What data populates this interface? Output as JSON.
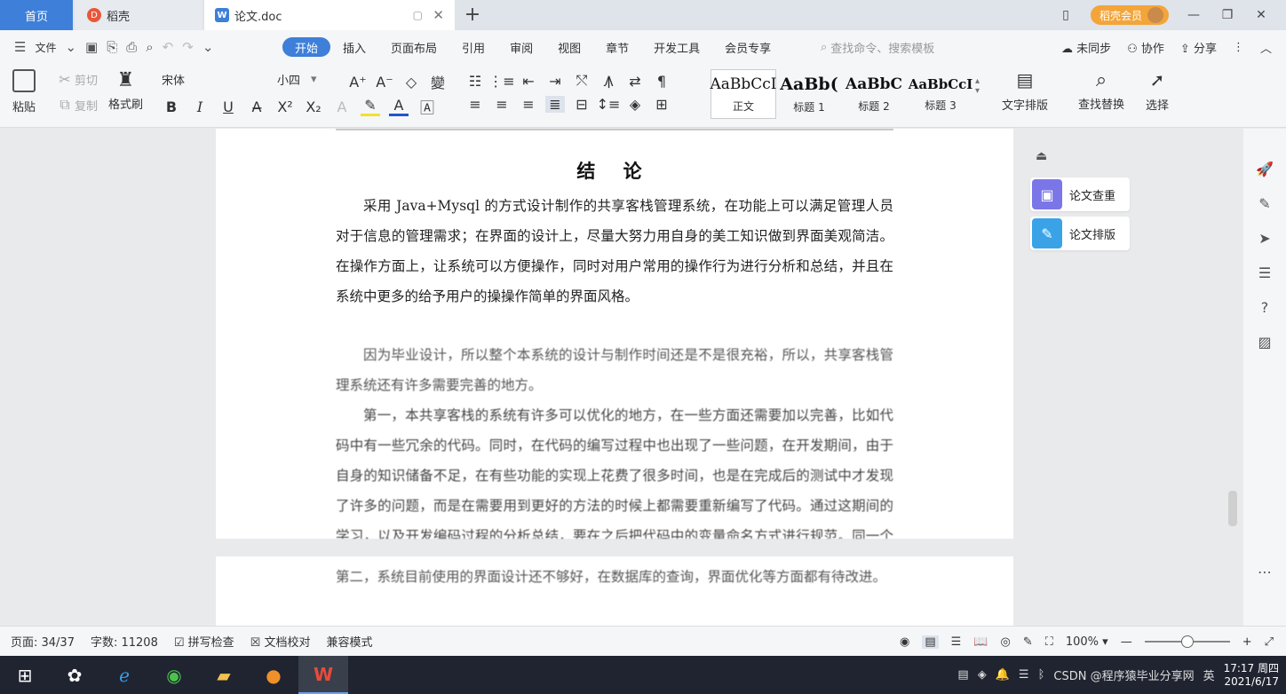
{
  "tabs": {
    "home": "首页",
    "daoke": "稻壳",
    "doc": "论文.doc",
    "new": "+"
  },
  "titlebar": {
    "member": "稻壳会员",
    "minimize": "—",
    "restore": "❐",
    "close": "✕"
  },
  "menu": {
    "file": "文件",
    "tabs": [
      "开始",
      "插入",
      "页面布局",
      "引用",
      "审阅",
      "视图",
      "章节",
      "开发工具",
      "会员专享"
    ],
    "search": "查找命令、搜索模板",
    "sync": "未同步",
    "collab": "协作",
    "share": "分享"
  },
  "ribbon": {
    "paste": "粘贴",
    "cut": "剪切",
    "copy": "复制",
    "format_painter": "格式刷",
    "font_name": "宋体",
    "font_size": "小四",
    "styles": [
      {
        "sample": "AaBbCcI",
        "name": "正文"
      },
      {
        "sample": "AaBb(",
        "name": "标题 1"
      },
      {
        "sample": "AaBbC",
        "name": "标题 2"
      },
      {
        "sample": "AaBbCcI",
        "name": "标题 3"
      }
    ],
    "text_layout": "文字排版",
    "find_replace": "查找替换",
    "select": "选择"
  },
  "document": {
    "title": "结  论",
    "p1": "采用 Java+Mysql 的方式设计制作的共享客栈管理系统，在功能上可以满足管理人员对于信息的管理需求；在界面的设计上，尽量大努力用自身的美工知识做到界面美观简洁。在操作方面上，让系统可以方便操作，同时对用户常用的操作行为进行分析和总结，并且在系统中更多的给予用户的操操作简单的界面风格。",
    "p2": "因为毕业设计，所以整个本系统的设计与制作时间还是不是很充裕，所以，共享客栈管理系统还有许多需要完善的地方。",
    "p3": "第一，本共享客栈的系统有许多可以优化的地方，在一些方面还需要加以完善，比如代码中有一些冗余的代码。同时，在代码的编写过程中也出现了一些问题，在开发期间，由于自身的知识储备不足，在有些功能的实现上花费了很多时间，也是在完成后的测试中才发现了许多的问题，而是在需要用到更好的方法的时候上都需要重新编写了代码。通过这期间的学习，以及开发编码过程的分析总结，要在之后把代码中的变量命名方式进行规范。同一个方面上，在之后的编码中，需要使用更高效的方法，即可以在以后的代码编写中让代码简洁，这样可以简化代码，也节省了开发时间和存储空间。",
    "p4": "第二，系统目前使用的界面设计还不够好，在数据库的查询，界面优化等方面都有待改进。"
  },
  "pane": {
    "check": "论文查重",
    "layout": "论文排版"
  },
  "status": {
    "page": "页面: 34/37",
    "words": "字数: 11208",
    "spell": "拼写检查",
    "proof": "文档校对",
    "compat": "兼容模式",
    "zoom": "100%",
    "zoom_level": 0.5
  },
  "taskbar": {
    "tray_text": "CSDN @程序猿毕业分享网",
    "ime": "英",
    "time": "17:17 周四",
    "date": "2021/6/17"
  }
}
